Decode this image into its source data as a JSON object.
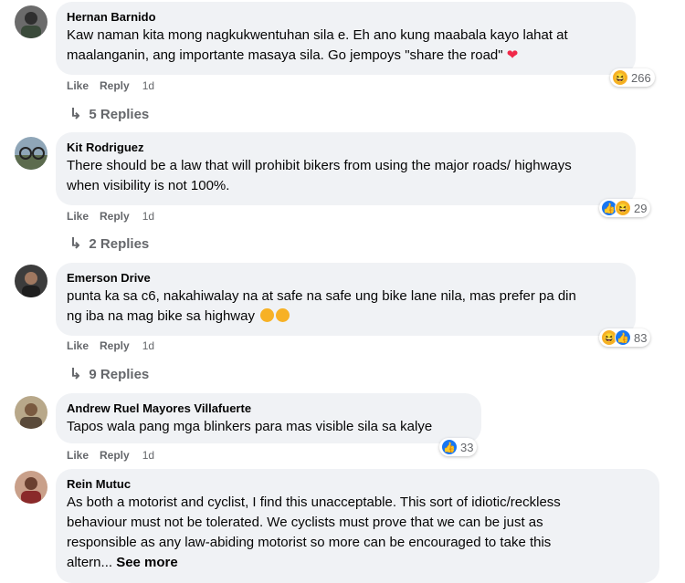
{
  "comments": [
    {
      "author": "Hernan Barnido",
      "text_lines": [
        "Kaw naman kita mong nagkukwentuhan sila e. Eh ano kung maabala kayo lahat at",
        "maalanganin, ang importante masaya sila. Go jempoys \"share the road\""
      ],
      "like": "Like",
      "reply": "Reply",
      "time": "1d",
      "reactions": [
        "haha"
      ],
      "reaction_count": "266",
      "replies": "5 Replies"
    },
    {
      "author": "Kit Rodriguez",
      "text_lines": [
        "There should be a law that will prohibit bikers from using the major roads/ highways",
        "when visibility is not 100%."
      ],
      "like": "Like",
      "reply": "Reply",
      "time": "1d",
      "reactions": [
        "like",
        "haha"
      ],
      "reaction_count": "29",
      "replies": "2 Replies"
    },
    {
      "author": "Emerson Drive",
      "text_lines": [
        "punta ka sa c6, nakahiwalay na at safe na safe ung bike lane nila, mas prefer pa din",
        "ng iba na mag bike sa highway"
      ],
      "like": "Like",
      "reply": "Reply",
      "time": "1d",
      "reactions": [
        "haha",
        "like"
      ],
      "reaction_count": "83",
      "replies": "9 Replies"
    },
    {
      "author": "Andrew Ruel Mayores Villafuerte",
      "text_lines": [
        "Tapos wala pang mga blinkers para mas visible sila sa kalye"
      ],
      "like": "Like",
      "reply": "Reply",
      "time": "1d",
      "reactions": [
        "like"
      ],
      "reaction_count": "33"
    },
    {
      "author": "Rein Mutuc",
      "text_lines": [
        "As both a motorist and cyclist, I find this unacceptable. This sort of idiotic/reckless",
        "behaviour must not be tolerated. We cyclists must prove that we can be just as",
        "responsible as any law-abiding motorist so more can be encouraged to take this",
        "altern..."
      ],
      "see_more": "See more"
    }
  ],
  "colors": {
    "bubble": "#f0f2f5",
    "meta": "#65676b",
    "like": "#1877f2",
    "haha": "#f7b125",
    "heart": "#f02849"
  }
}
